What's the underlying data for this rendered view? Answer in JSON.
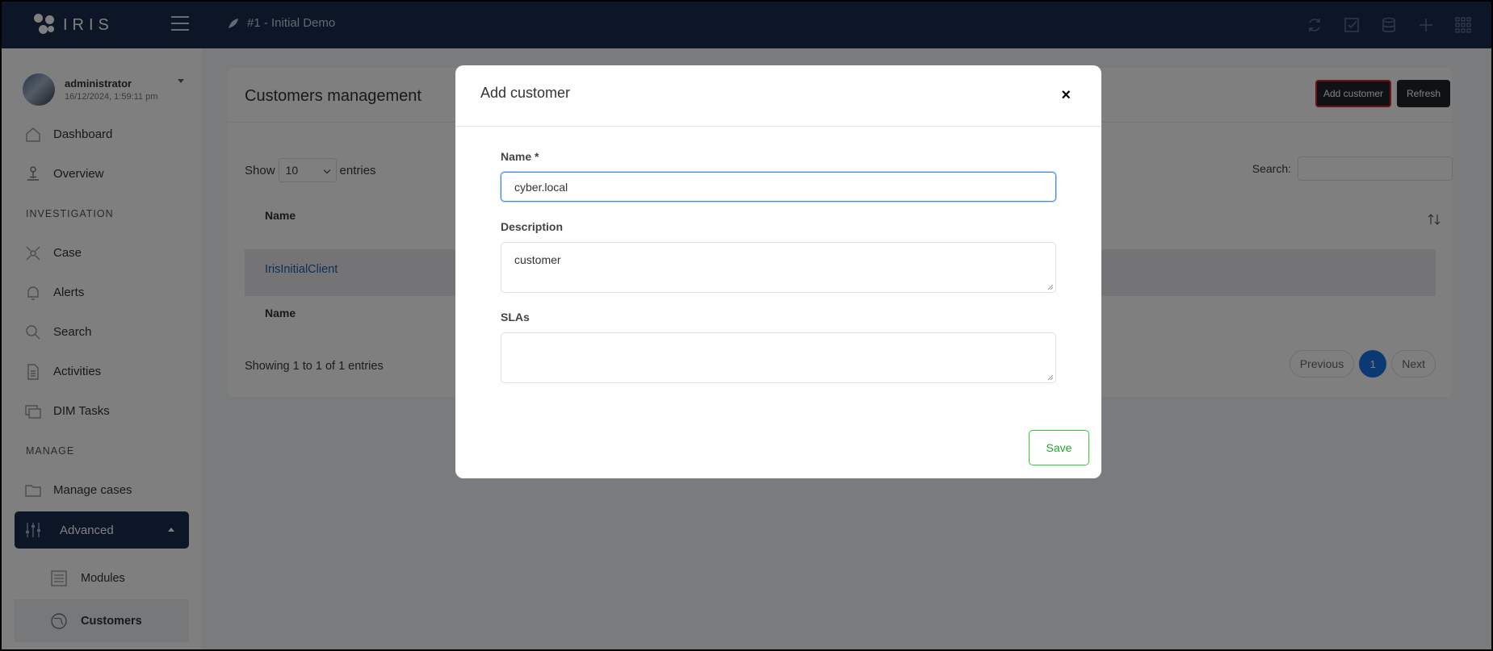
{
  "app": {
    "logo_text": "IRIS",
    "case_title": "#1 - Initial Demo"
  },
  "user": {
    "name": "administrator",
    "datetime": "16/12/2024, 1:59:11 pm"
  },
  "sidebar": {
    "items": [
      {
        "label": "Dashboard",
        "icon": "home-icon"
      },
      {
        "label": "Overview",
        "icon": "overview-icon"
      }
    ],
    "section_investigation": "INVESTIGATION",
    "investigation_items": [
      {
        "label": "Case",
        "icon": "case-icon"
      },
      {
        "label": "Alerts",
        "icon": "bell-icon"
      },
      {
        "label": "Search",
        "icon": "search-icon"
      },
      {
        "label": "Activities",
        "icon": "document-icon"
      },
      {
        "label": "DIM Tasks",
        "icon": "tasks-icon"
      }
    ],
    "section_manage": "MANAGE",
    "manage_items": [
      {
        "label": "Manage cases",
        "icon": "folder-icon"
      },
      {
        "label": "Advanced",
        "icon": "sliders-icon"
      }
    ],
    "advanced_sub": [
      {
        "label": "Modules",
        "icon": "list-icon"
      },
      {
        "label": "Customers",
        "icon": "globe-icon"
      }
    ]
  },
  "main": {
    "title": "Customers management",
    "add_button": "Add customer",
    "refresh_button": "Refresh",
    "show_label": "Show",
    "entries_label": "entries",
    "page_size": "10",
    "search_label": "Search:",
    "column_header": "Name",
    "rows": [
      "IrisInitialClient"
    ],
    "footer_header": "Name",
    "showing_text": "Showing 1 to 1 of 1 entries",
    "pagination": {
      "previous": "Previous",
      "current": "1",
      "next": "Next"
    }
  },
  "modal": {
    "title": "Add customer",
    "close": "×",
    "name_label": "Name *",
    "name_value": "cyber.local",
    "description_label": "Description",
    "description_value": "customer",
    "slas_label": "SLAs",
    "slas_value": "",
    "save_button": "Save"
  },
  "colors": {
    "topbar": "#1a2c4e",
    "accent": "#1572e8",
    "save": "#31ce36",
    "highlight_border": "#e02020"
  }
}
